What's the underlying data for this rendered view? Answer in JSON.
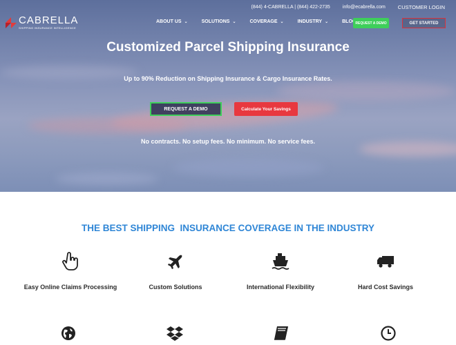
{
  "topbar": {
    "phone": "(844) 4-CABRELLA | (844) 422-2735",
    "email": "info@ecabrella.com",
    "login": "CUSTOMER LOGIN"
  },
  "logo": {
    "name": "CABRELLA",
    "tagline": "SHIPPING INSURANCE INTELLIGENCE"
  },
  "nav": {
    "items": [
      {
        "label": "ABOUT US",
        "dropdown": true
      },
      {
        "label": "SOLUTIONS",
        "dropdown": true
      },
      {
        "label": "COVERAGE",
        "dropdown": true
      },
      {
        "label": "INDUSTRY",
        "dropdown": true
      },
      {
        "label": "BLOG",
        "dropdown": false
      }
    ],
    "demo_button": "REQUEST A DEMO",
    "started_button": "GET STARTED"
  },
  "hero": {
    "title": "Customized Parcel Shipping Insurance",
    "subtitle": "Up to 90% Reduction on Shipping Insurance & Cargo Insurance Rates.",
    "demo_button": "REQUEST A DEMO",
    "calc_button": "Calculate Your Savings",
    "note": "No contracts. No setup fees. No minimum. No service fees."
  },
  "coverage": {
    "title": "THE BEST SHIPPING  INSURANCE COVERAGE IN THE INDUSTRY",
    "features": [
      {
        "label": "Easy Online Claims Processing",
        "icon": "hand-pointer-icon"
      },
      {
        "label": "Custom Solutions",
        "icon": "plane-icon"
      },
      {
        "label": "International Flexibility",
        "icon": "ship-icon"
      },
      {
        "label": "Hard Cost Savings",
        "icon": "truck-icon"
      }
    ],
    "more_icons": [
      "globe-icon",
      "dropbox-icon",
      "book-icon",
      "clock-icon"
    ]
  },
  "colors": {
    "accent_blue": "#2f86d6",
    "green": "#3ecf5a",
    "red": "#e8383f"
  }
}
